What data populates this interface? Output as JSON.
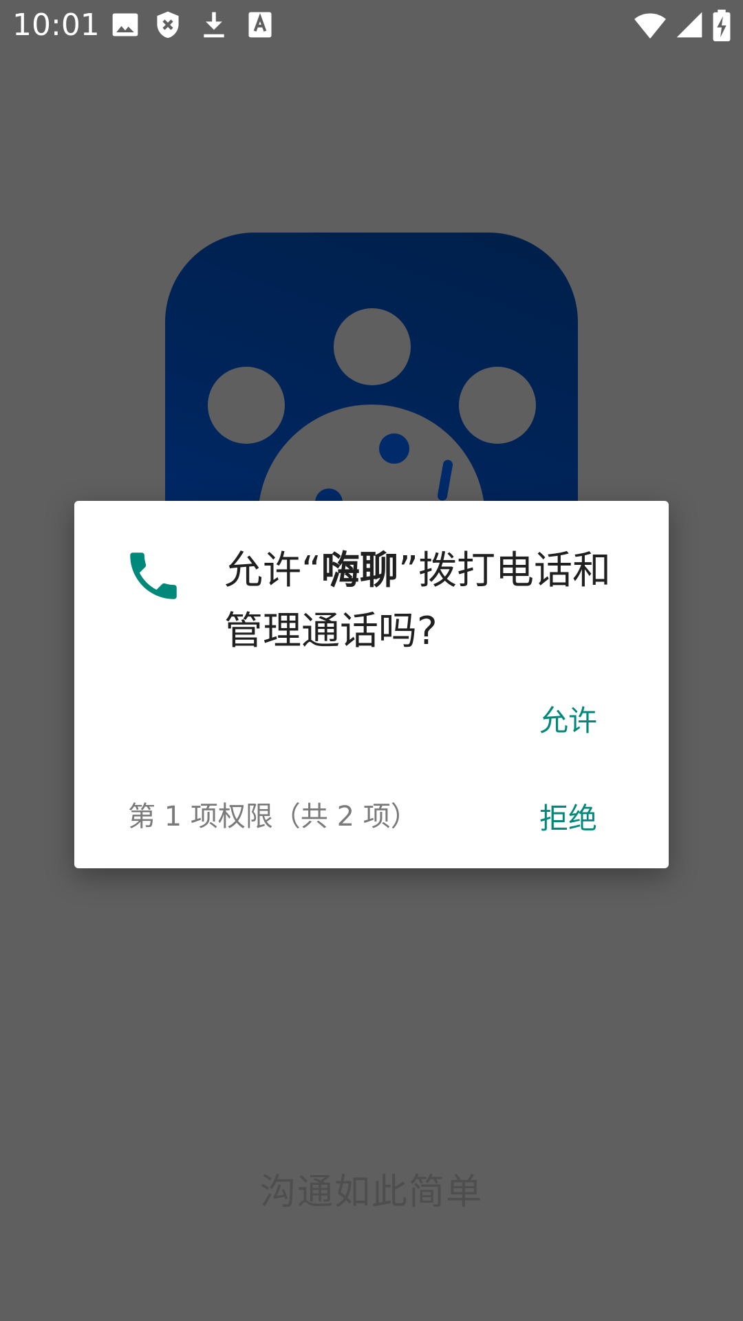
{
  "status_bar": {
    "time": "10:01",
    "left_icons": [
      "image-icon",
      "shield-x-icon",
      "download-icon",
      "a11y-text-icon"
    ],
    "right_icons": [
      "wifi-icon",
      "signal-icon",
      "battery-charging-icon"
    ]
  },
  "splash": {
    "logo": "app-logo",
    "slogan": "沟通如此简单"
  },
  "dialog": {
    "icon": "phone-icon",
    "accent_color": "#00897b",
    "title_prefix": "允许“",
    "app_name": "嗨聊",
    "title_suffix": "”拨打电话和管理通话吗?",
    "allow_label": "允许",
    "deny_label": "拒绝",
    "counter_text": "第 1 项权限（共 2 项）"
  }
}
